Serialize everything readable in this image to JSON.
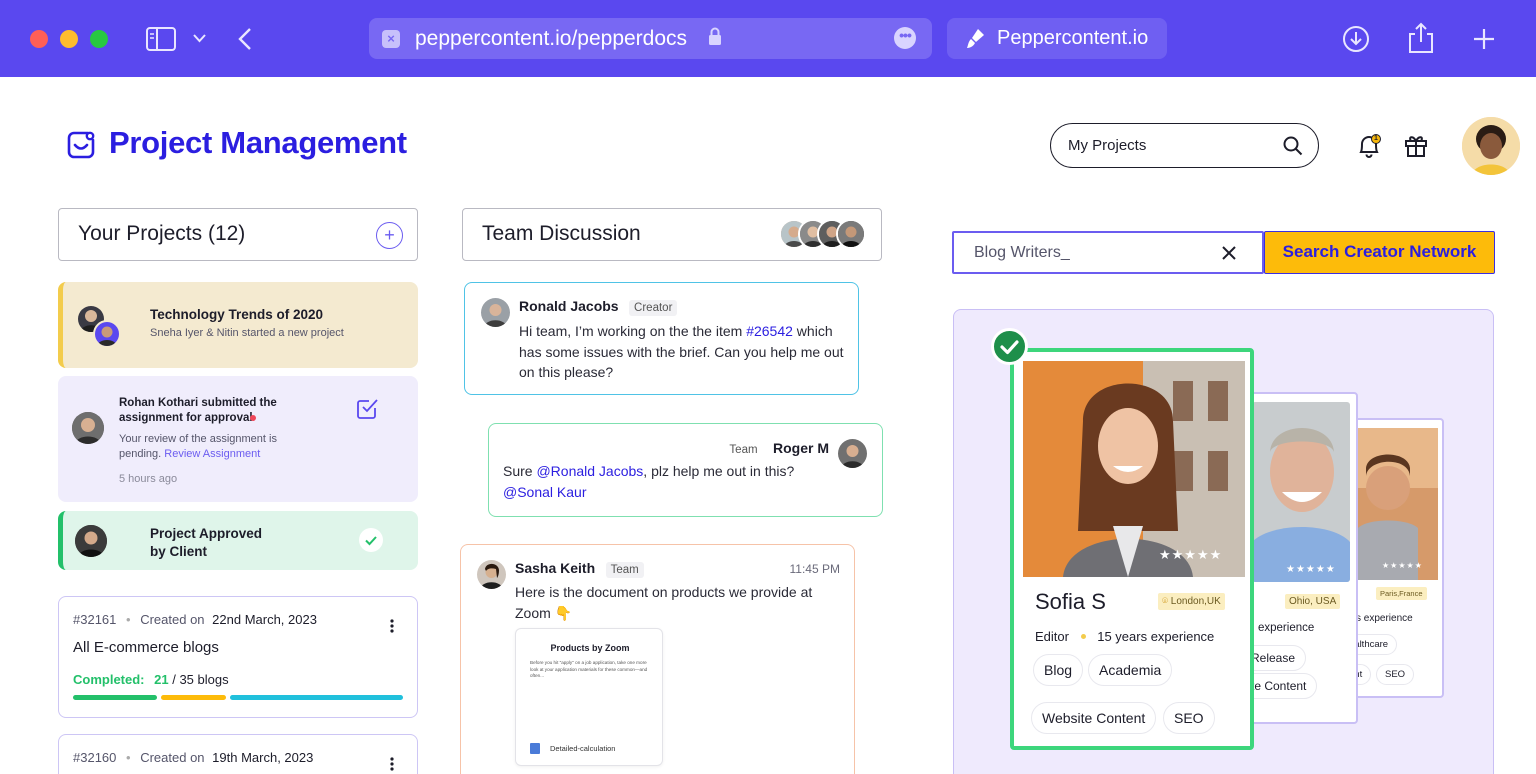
{
  "browser": {
    "url": "peppercontent.io/pepperdocs",
    "tab_title": "Peppercontent.io"
  },
  "header": {
    "title": "Project Management",
    "search_placeholder": "My Projects",
    "notification_count": "1"
  },
  "projects": {
    "title": "Your Projects (12)",
    "feed": [
      {
        "title": "Technology Trends of 2020",
        "subtitle": "Sneha Iyer & Nitin started a new project"
      },
      {
        "title": "Rohan Kothari submitted the assignment for approval",
        "body": "Your review of the assignment is pending.",
        "link": "Review Assignment",
        "time": "5 hours ago"
      },
      {
        "title": "Project Approved by Client"
      }
    ],
    "items": [
      {
        "id": "#32161",
        "created_label": "Created on",
        "created_date": "22nd March, 2023",
        "name": "All E-commerce blogs",
        "status_label": "Completed:",
        "done": "21",
        "total": "/ 35 blogs"
      },
      {
        "id": "#32160",
        "created_label": "Created on",
        "created_date": "19th March, 2023"
      }
    ]
  },
  "discussion": {
    "title": "Team Discussion",
    "messages": [
      {
        "author": "Ronald Jacobs",
        "role": "Creator",
        "text_before": "Hi team, I’m working on the the item ",
        "ref": "#26542",
        "text_after": " which has some issues with the brief. Can you help me out on this please?"
      },
      {
        "author": "Roger M",
        "role": "Team",
        "text_before": "Sure ",
        "mention1": "@Ronald Jacobs",
        "text_mid": ", plz help me out in this?",
        "mention2": "@Sonal Kaur"
      },
      {
        "author": "Sasha Keith",
        "role": "Team",
        "time": "11:45 PM",
        "text": "Here is the document on products we provide at Zoom 👇",
        "doc_title": "Products by Zoom",
        "doc_body": "Before you hit \"apply\" on a job application, take one more look at your application materials for these common—and often...",
        "doc_file": "Detailed-calculation"
      }
    ]
  },
  "creators": {
    "search_value": "Blog Writers_",
    "search_button": "Search Creator Network",
    "cards": [
      {
        "name": "Sofia S",
        "location": "London,UK",
        "role": "Editor",
        "experience": "15 years experience",
        "tags": [
          "Blog",
          "Academia",
          "Website Content",
          "SEO"
        ],
        "rating": "★★★★★"
      },
      {
        "location": "Ohio, USA",
        "experience_partial": "experience",
        "tags_partial": [
          "Release",
          "te Content"
        ],
        "rating": "★★★★★"
      },
      {
        "location": "Paris,France",
        "experience_partial": "s experience",
        "tags_partial": [
          "ealthcare",
          "ent",
          "SEO"
        ],
        "rating": "★★★★★"
      }
    ]
  },
  "colors": {
    "brand": "#5a48ef",
    "title": "#2b1ee0",
    "accent_yellow": "#fdbb0a",
    "success": "#23c06a"
  }
}
